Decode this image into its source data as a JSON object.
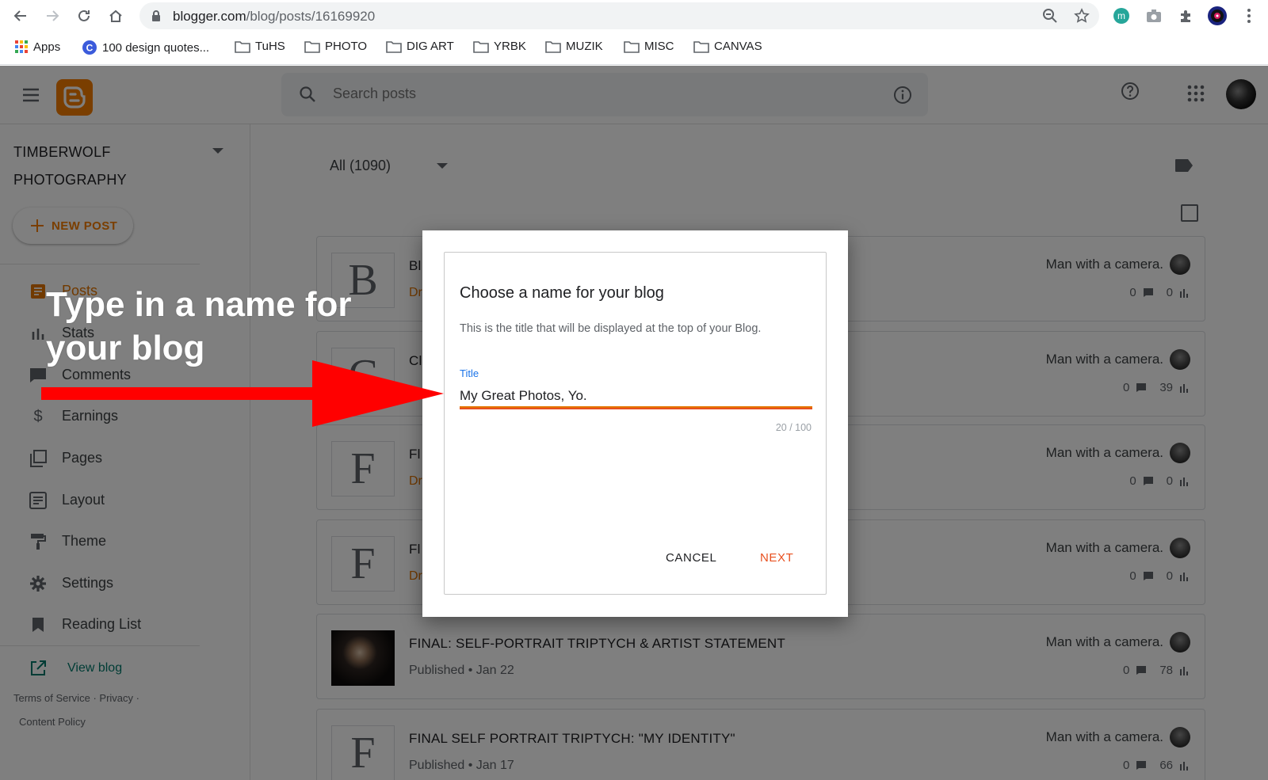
{
  "browser": {
    "url_host": "blogger.com",
    "url_path": "/blog/posts/16169920",
    "extension_m_label": "m"
  },
  "bookmarks": [
    {
      "label": "Apps",
      "icon": "apps-grid-icon"
    },
    {
      "label": "100 design quotes...",
      "icon": "c-favicon"
    },
    {
      "label": "TuHS",
      "icon": "folder-icon"
    },
    {
      "label": "PHOTO",
      "icon": "folder-icon"
    },
    {
      "label": "DIG ART",
      "icon": "folder-icon"
    },
    {
      "label": "YRBK",
      "icon": "folder-icon"
    },
    {
      "label": "MUZIK",
      "icon": "folder-icon"
    },
    {
      "label": "MISC",
      "icon": "folder-icon"
    },
    {
      "label": "CANVAS",
      "icon": "folder-icon"
    }
  ],
  "app": {
    "search_placeholder": "Search posts",
    "blog_name_line1": "TIMBERWOLF",
    "blog_name_line2": "PHOTOGRAPHY",
    "new_post_label": "NEW POST",
    "nav": [
      {
        "label": "Posts",
        "icon": "posts-icon"
      },
      {
        "label": "Stats",
        "icon": "stats-icon"
      },
      {
        "label": "Comments",
        "icon": "comments-icon"
      },
      {
        "label": "Earnings",
        "icon": "dollar-icon"
      },
      {
        "label": "Pages",
        "icon": "pages-icon"
      },
      {
        "label": "Layout",
        "icon": "layout-icon"
      },
      {
        "label": "Theme",
        "icon": "paint-roller-icon"
      },
      {
        "label": "Settings",
        "icon": "gear-icon"
      },
      {
        "label": "Reading List",
        "icon": "bookmark-icon"
      }
    ],
    "view_blog_label": "View blog",
    "footer": {
      "terms": "Terms of Service",
      "sep1": "·",
      "privacy": "Privacy",
      "sep2": "·",
      "content_policy": "Content Policy"
    },
    "filter_label": "All (1090)",
    "accent_color": "#f57d00"
  },
  "posts": [
    {
      "thumb_letter": "B",
      "title": "Bl",
      "status": "Dr",
      "author": "Man with a camera.",
      "comments": "0",
      "views": "0"
    },
    {
      "thumb_letter": "C",
      "title": "Cl",
      "status": "",
      "author": "Man with a camera.",
      "comments": "0",
      "views": "39"
    },
    {
      "thumb_letter": "F",
      "title": "Fl",
      "status": "Dr",
      "author": "Man with a camera.",
      "comments": "0",
      "views": "0"
    },
    {
      "thumb_letter": "F",
      "title": "Fl",
      "status": "Dr",
      "author": "Man with a camera.",
      "comments": "0",
      "views": "0"
    },
    {
      "thumb_letter": "",
      "title": "FINAL: SELF-PORTRAIT TRIPTYCH & ARTIST STATEMENT",
      "status": "Published • Jan 22",
      "author": "Man with a camera.",
      "comments": "0",
      "views": "78"
    },
    {
      "thumb_letter": "F",
      "title": "FINAL SELF PORTRAIT TRIPTYCH: \"MY IDENTITY\"",
      "status": "Published • Jan 17",
      "author": "Man with a camera.",
      "comments": "0",
      "views": "66"
    }
  ],
  "dialog": {
    "title": "Choose a name for your blog",
    "subtitle": "This is the title that will be displayed at the top of your Blog.",
    "field_label": "Title",
    "field_value": "My Great Photos, Yo.",
    "counter": "20 / 100",
    "cancel_label": "CANCEL",
    "next_label": "NEXT"
  },
  "annotation": {
    "callout_text": "Type in a name for your blog",
    "arrow_color": "#ff0000"
  }
}
